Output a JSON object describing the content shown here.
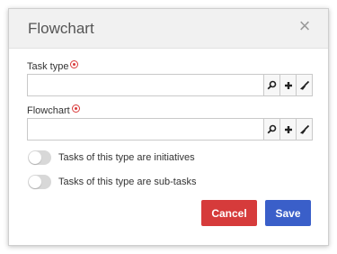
{
  "dialog": {
    "title": "Flowchart",
    "close_glyph": "×"
  },
  "fields": {
    "task_type": {
      "label": "Task type",
      "value": "",
      "placeholder": ""
    },
    "flowchart": {
      "label": "Flowchart",
      "value": "",
      "placeholder": ""
    }
  },
  "field_icons": [
    "search-icon",
    "plus-icon",
    "clear-brush-icon"
  ],
  "toggles": {
    "initiatives": {
      "label": "Tasks of this type are initiatives",
      "on": false
    },
    "subtasks": {
      "label": "Tasks of this type are sub-tasks",
      "on": false
    }
  },
  "buttons": {
    "cancel": "Cancel",
    "save": "Save"
  },
  "colors": {
    "cancel": "#d63b3b",
    "save": "#3a5fc9",
    "required": "#d93a3a"
  }
}
